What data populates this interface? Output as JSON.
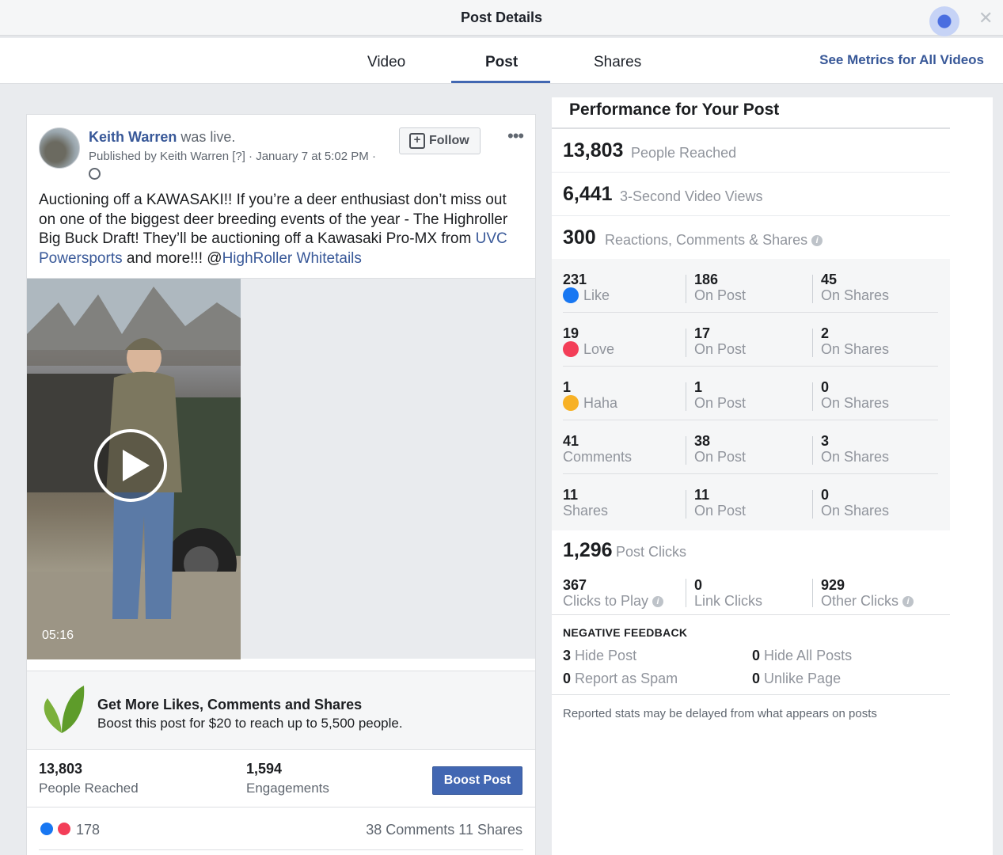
{
  "header": {
    "title": "Post Details"
  },
  "tabs": [
    {
      "label": "Video"
    },
    {
      "label": "Post"
    },
    {
      "label": "Shares"
    }
  ],
  "all_videos_link": "See Metrics for All Videos",
  "post": {
    "author": "Keith Warren",
    "action": "was live.",
    "meta": "Published by Keith Warren [?] · January 7 at 5:02 PM ·",
    "follow_label": "Follow",
    "text_parts": [
      "Auctioning off a KAWASAKI!! If you’re a deer enthusiast don’t miss out on one of the biggest deer breeding events of the year - The Highroller Big Buck Draft! They’ll be auctioning off a Kawasaki Pro-MX from ",
      "UVC Powersports",
      " and more!!! @",
      "HighRoller Whitetails"
    ],
    "video_duration": "05:16",
    "boost": {
      "title": "Get More Likes, Comments and Shares",
      "subtitle": "Boost this post for $20 to reach up to 5,500 people.",
      "button_label": "Boost Post"
    },
    "stats": [
      {
        "value": "13,803",
        "label": "People Reached"
      },
      {
        "value": "1,594",
        "label": "Engagements"
      }
    ],
    "reaction_count": "178",
    "comments_shares": "38 Comments  11 Shares"
  },
  "performance": {
    "title": "Performance for Your Post",
    "metrics": [
      {
        "value": "13,803",
        "label": "People Reached"
      },
      {
        "value": "6,441",
        "label": "3-Second Video Views"
      },
      {
        "value": "300",
        "label": "Reactions, Comments & Shares"
      }
    ],
    "breakdown": [
      {
        "total": "231",
        "label": "Like",
        "icon": "like-icon",
        "on_post": "186",
        "on_shares": "45"
      },
      {
        "total": "19",
        "label": "Love",
        "icon": "love-icon",
        "on_post": "17",
        "on_shares": "2"
      },
      {
        "total": "1",
        "label": "Haha",
        "icon": "haha-icon",
        "on_post": "1",
        "on_shares": "0"
      },
      {
        "total": "41",
        "label": "Comments",
        "icon": "",
        "on_post": "38",
        "on_shares": "3"
      },
      {
        "total": "11",
        "label": "Shares",
        "icon": "",
        "on_post": "11",
        "on_shares": "0"
      }
    ],
    "on_post_label": "On Post",
    "on_shares_label": "On Shares",
    "post_clicks": {
      "value": "1,296",
      "label": "Post Clicks"
    },
    "clicks": [
      {
        "value": "367",
        "label": "Clicks to Play"
      },
      {
        "value": "0",
        "label": "Link Clicks"
      },
      {
        "value": "929",
        "label": "Other Clicks"
      }
    ],
    "negative": {
      "title": "NEGATIVE FEEDBACK",
      "items": [
        {
          "value": "3",
          "label": "Hide Post"
        },
        {
          "value": "0",
          "label": "Hide All Posts"
        },
        {
          "value": "0",
          "label": "Report as Spam"
        },
        {
          "value": "0",
          "label": "Unlike Page"
        }
      ]
    },
    "note": "Reported stats may be delayed from what appears on posts"
  },
  "colors": {
    "accent": "#4267b2",
    "link": "#385898",
    "like": "#1877f2",
    "love": "#f33e58",
    "haha": "#f7b125"
  }
}
